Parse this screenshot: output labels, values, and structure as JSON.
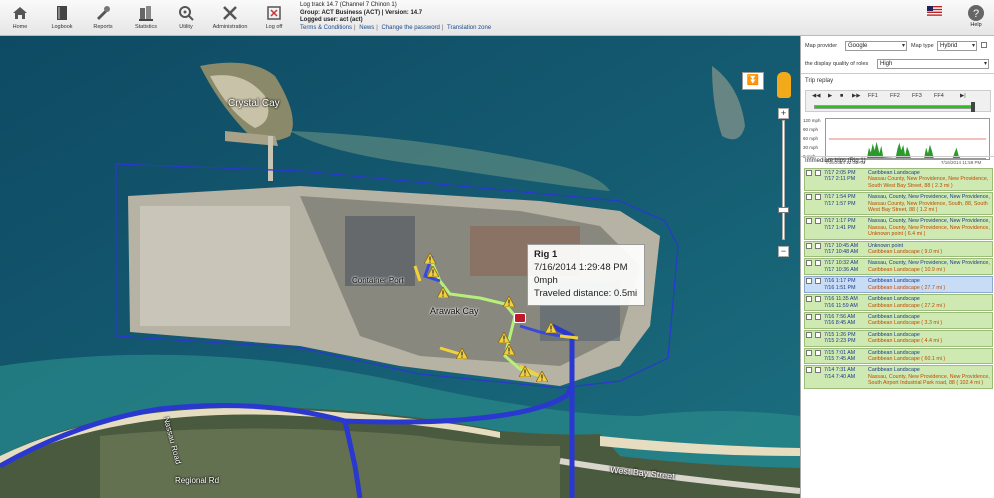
{
  "toolbar": {
    "items": [
      {
        "label": "Home",
        "icon": "home-icon"
      },
      {
        "label": "Logbook",
        "icon": "logbook-icon"
      },
      {
        "label": "Reports",
        "icon": "reports-icon"
      },
      {
        "label": "Statistics",
        "icon": "statistics-icon"
      },
      {
        "label": "Utility",
        "icon": "utility-icon"
      },
      {
        "label": "Administration",
        "icon": "administration-icon"
      },
      {
        "label": "Log off",
        "icon": "log-off-icon"
      }
    ],
    "help_label": "Help"
  },
  "info": {
    "line1": "Log track 14.7 (Channel 7 Chinon 1)",
    "line2": "Group: ACT Business (ACT) | Version: 14.7",
    "line3": "Logged user: act (act)",
    "links": [
      "Terms & Conditions",
      "News",
      "Change the password",
      "Translation zone"
    ]
  },
  "map": {
    "labels": {
      "crystal_cay": "Crystal Cay",
      "container_port": "Container Port",
      "arawak_cay": "Arawak Cay",
      "west_bay_street": "West Bay Street",
      "nassau_road": "Nassau Road",
      "regional_rd": "Regional Rd"
    },
    "popup": {
      "title": "Rig 1",
      "datetime": "7/16/2014 1:29:48 PM",
      "speed": "0mph",
      "distance": "Traveled distance: 0.5mi"
    },
    "route_color": "#2a38d0",
    "trail_color": "#b6f07a",
    "zoom_in": "+",
    "zoom_out": "−"
  },
  "panel": {
    "map_provider_label": "Map provider",
    "map_provider_value": "Google",
    "map_type_label": "Map type",
    "map_type_value": "Hybrid",
    "quality_label": "the display quality of roles",
    "quality_value": "High",
    "replay_title": "Trip replay",
    "speed_axis": [
      "120 mph",
      "90 mph",
      "60 mph",
      "30 mph",
      "0 mph"
    ],
    "graph_dates": [
      "7/16/2014 12:00 AM",
      "7/16/2014 11:59 PM"
    ],
    "controls": [
      "◀◀",
      "▶",
      "■",
      "▶▶",
      "FF1",
      "FF2",
      "FF3",
      "FF4",
      "▶|"
    ],
    "trips_title": "Immediate trips (Rig 1)",
    "trips": [
      {
        "start": "7/17 2:05 PM",
        "end": "7/17 2:11 PM",
        "origin": "Caribbean Landscape",
        "dest": "Nassau County, New Providence, New Providence, South West Bay Street, 88 ( 2.3 mi )",
        "selected": false
      },
      {
        "start": "7/17 1:54 PM",
        "end": "7/17 1:57 PM",
        "origin": "Nassau, County, New Providence, New Providence,",
        "dest": "Nassau County, New Providence, South, 88, South West Bay Street, 88 ( 1.2 mi )",
        "selected": false
      },
      {
        "start": "7/17 1:17 PM",
        "end": "7/17 1:41 PM",
        "origin": "Nassau, County, New Providence, New Providence,",
        "dest": "Nassau, County, New Providence, New Providence, Unknown point ( 6.4 mi )",
        "selected": false
      },
      {
        "start": "7/17 10:45 AM",
        "end": "7/17 10:48 AM",
        "origin": "Unknown point",
        "dest": "Caribbean Landscape ( 9.0 mi )",
        "selected": false
      },
      {
        "start": "7/17 10:32 AM",
        "end": "7/17 10:36 AM",
        "origin": "Nassau, County, New Providence, New Providence,",
        "dest": "Caribbean Landscape ( 10.9 mi )",
        "selected": false
      },
      {
        "start": "7/16 1:17 PM",
        "end": "7/16 1:51 PM",
        "origin": "Caribbean Landscape",
        "dest": "Caribbean Landscape ( 27.7 mi )",
        "selected": true
      },
      {
        "start": "7/16 11:35 AM",
        "end": "7/16 11:59 AM",
        "origin": "Caribbean Landscape",
        "dest": "Caribbean Landscape ( 27.2 mi )",
        "selected": false
      },
      {
        "start": "7/16 7:56 AM",
        "end": "7/16 8:45 AM",
        "origin": "Caribbean Landscape",
        "dest": "Caribbean Landscape ( 3.3 mi )",
        "selected": false
      },
      {
        "start": "7/15 1:26 PM",
        "end": "7/15 2:23 PM",
        "origin": "Caribbean Landscape",
        "dest": "Caribbean Landscape ( 4.4 mi )",
        "selected": false
      },
      {
        "start": "7/15 7:01 AM",
        "end": "7/15 7:45 AM",
        "origin": "Caribbean Landscape",
        "dest": "Caribbean Landscape ( 60.1 mi )",
        "selected": false
      },
      {
        "start": "7/14 7:31 AM",
        "end": "7/14 7:40 AM",
        "origin": "Caribbean Landscape",
        "dest": "Nassau, County, New Providence, New Providence, South Airport Industrial Park road, 88 ( 102.4 mi )",
        "selected": false
      }
    ]
  }
}
